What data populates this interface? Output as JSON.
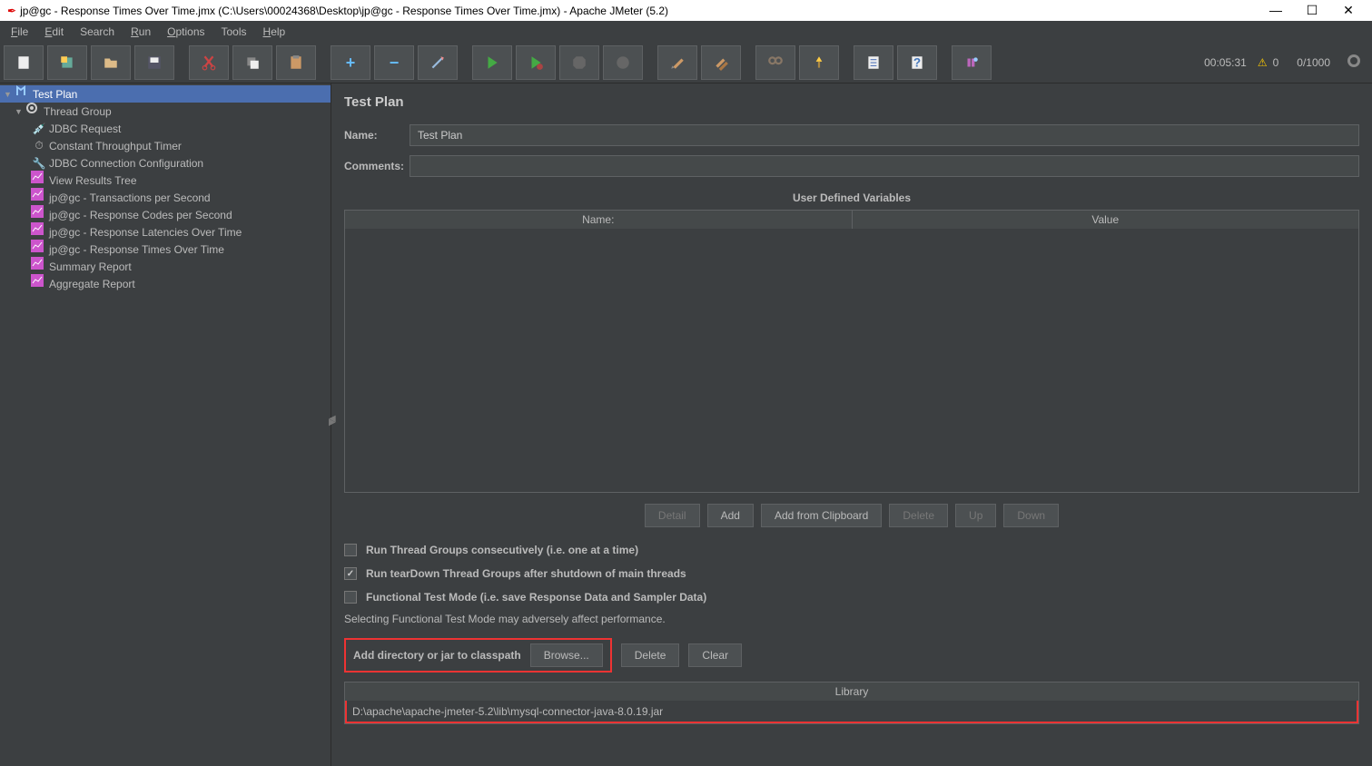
{
  "window": {
    "title": "jp@gc - Response Times Over Time.jmx (C:\\Users\\00024368\\Desktop\\jp@gc - Response Times Over Time.jmx) - Apache JMeter (5.2)"
  },
  "menu": {
    "file": "File",
    "edit": "Edit",
    "search": "Search",
    "run": "Run",
    "options": "Options",
    "tools": "Tools",
    "help": "Help"
  },
  "status": {
    "elapsed": "00:05:31",
    "warnings": "0",
    "threads": "0/1000"
  },
  "tree": {
    "testplan": "Test Plan",
    "threadgroup": "Thread Group",
    "items": [
      "JDBC Request",
      "Constant Throughput Timer",
      "JDBC Connection Configuration",
      "View Results Tree",
      "jp@gc - Transactions per Second",
      "jp@gc - Response Codes per Second",
      "jp@gc - Response Latencies Over Time",
      "jp@gc - Response Times Over Time",
      "Summary Report",
      "Aggregate Report"
    ]
  },
  "panel": {
    "title": "Test Plan",
    "name_label": "Name:",
    "name_value": "Test Plan",
    "comments_label": "Comments:",
    "comments_value": "",
    "udv_title": "User Defined Variables",
    "col_name": "Name:",
    "col_value": "Value",
    "btn_detail": "Detail",
    "btn_add": "Add",
    "btn_add_clip": "Add from Clipboard",
    "btn_delete": "Delete",
    "btn_up": "Up",
    "btn_down": "Down",
    "cb_consecutive": "Run Thread Groups consecutively (i.e. one at a time)",
    "cb_teardown": "Run tearDown Thread Groups after shutdown of main threads",
    "cb_functional": "Functional Test Mode (i.e. save Response Data and Sampler Data)",
    "note": "Selecting Functional Test Mode may adversely affect performance.",
    "classpath_label": "Add directory or jar to classpath",
    "btn_browse": "Browse...",
    "btn_cp_delete": "Delete",
    "btn_cp_clear": "Clear",
    "lib_header": "Library",
    "lib_entry": "D:\\apache\\apache-jmeter-5.2\\lib\\mysql-connector-java-8.0.19.jar"
  }
}
